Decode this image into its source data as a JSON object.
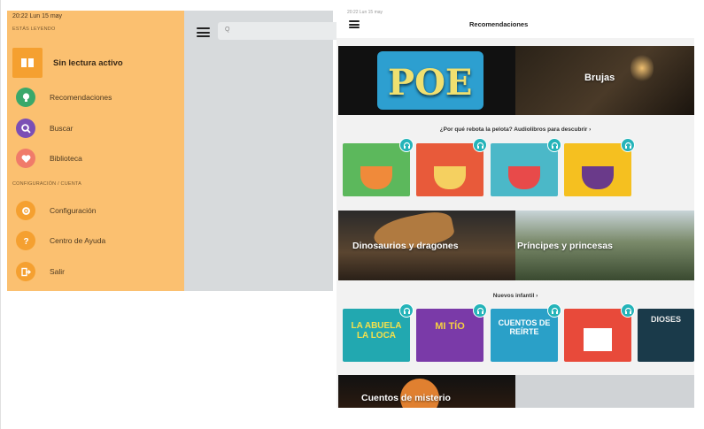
{
  "drawer": {
    "status_time": "20:22  Lun 15 may",
    "section_reading": "ESTÁS LEYENDO",
    "no_active": "Sin lectura activo",
    "section_config": "CONFIGURACIÓN / CUENTA",
    "items": [
      {
        "label": "Recomendaciones",
        "icon": "lightbulb-icon",
        "color": "#3aa86a"
      },
      {
        "label": "Buscar",
        "icon": "search-icon",
        "color": "#7b4fb5"
      },
      {
        "label": "Biblioteca",
        "icon": "heart-icon",
        "color": "#f07b6a"
      }
    ],
    "config_items": [
      {
        "label": "Configuración",
        "icon": "gear-icon",
        "color": "#f5a030"
      },
      {
        "label": "Centro de Ayuda",
        "icon": "help-icon",
        "color": "#f5a030"
      },
      {
        "label": "Salir",
        "icon": "logout-icon",
        "color": "#f5a030"
      }
    ]
  },
  "search": {
    "placeholder": "Q"
  },
  "right": {
    "top_status": "20:22  Lun 15 may",
    "title": "Recomendaciones",
    "banners": [
      {
        "label": "POE",
        "kind": "poe",
        "color": "#2d9fd0"
      },
      {
        "label": "Brujas",
        "kind": "dark"
      },
      {
        "label": "Dinosaurios y dragones",
        "kind": "dino"
      },
      {
        "label": "Príncipes y princesas",
        "kind": "forest"
      },
      {
        "label": "Cuentos de misterio",
        "kind": "mystery"
      }
    ],
    "section1_title": "¿Por qué rebota la pelota? Audiolibros para descubrir  ›",
    "section1_covers": [
      {
        "color": "#5cb85c",
        "accent": "#f08a3a"
      },
      {
        "color": "#e85a3a",
        "accent": "#f5d060"
      },
      {
        "color": "#4bb8c8",
        "accent": "#e84a4a"
      },
      {
        "color": "#f5c020",
        "accent": "#6a3a8a"
      }
    ],
    "section2_title": "Nuevos infantil  ›",
    "section2_covers": [
      {
        "title": "LA ABUELA LA LOCA",
        "color": "#22a8b0"
      },
      {
        "title": "MI TÍO",
        "color": "#7a3aa8"
      },
      {
        "title": "CUENTOS DE REÍRTE",
        "color": "#2aa0c8"
      },
      {
        "title": "",
        "color": "#e84a3a"
      },
      {
        "title": "DIOSES",
        "color": "#1a3a4a"
      }
    ]
  }
}
